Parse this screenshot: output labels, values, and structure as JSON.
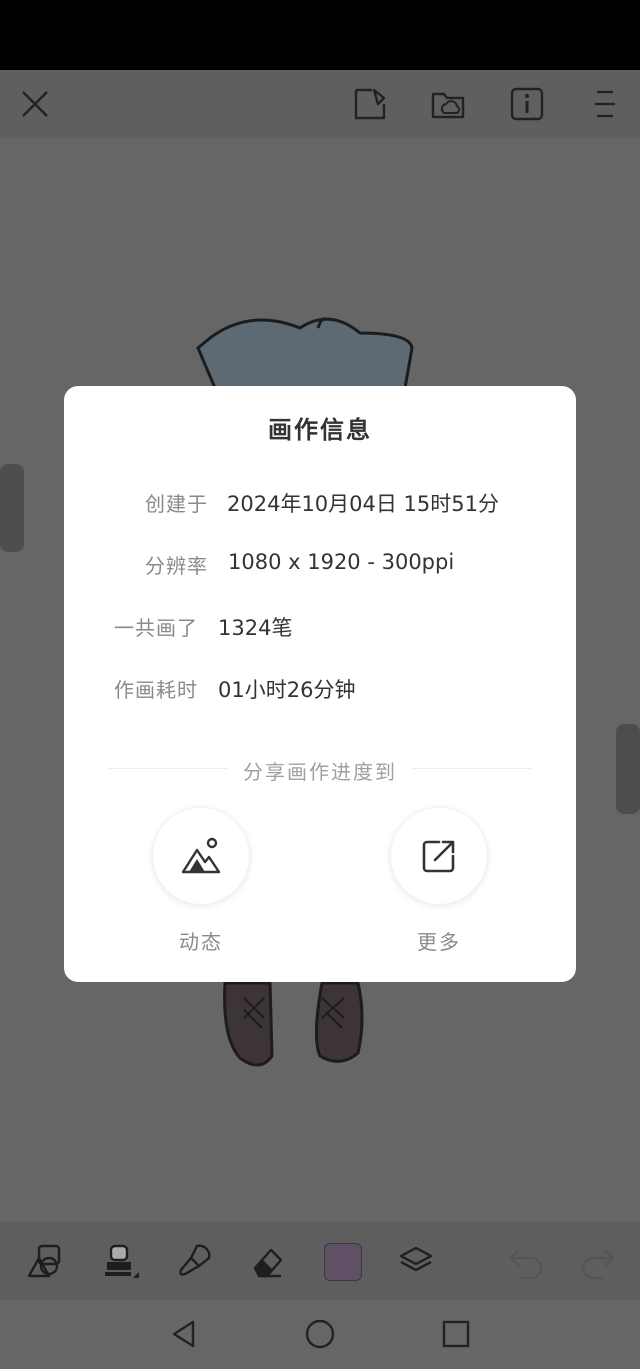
{
  "colors": {
    "accent_swatch": "#5f5066",
    "dialog_bg": "#ffffff",
    "dim_background": "#666666"
  },
  "top_bar": {
    "icons": [
      "close-icon",
      "export-image-icon",
      "cloud-folder-icon",
      "info-icon",
      "menu-icon"
    ]
  },
  "dialog": {
    "title": "画作信息",
    "rows": [
      {
        "label": "创建于",
        "value": "2024年10月04日 15时51分"
      },
      {
        "label": "分辨率",
        "value": "1080 x 1920 - 300ppi"
      },
      {
        "label": "一共画了",
        "value": "1324笔"
      },
      {
        "label": "作画耗时",
        "value": "01小时26分钟"
      }
    ],
    "share_title": "分享画作进度到",
    "share_options": [
      {
        "label": "动态",
        "icon": "mountain-image-icon"
      },
      {
        "label": "更多",
        "icon": "external-share-icon"
      }
    ]
  },
  "toolbar": {
    "tools": [
      "shape-icon",
      "brush-icon",
      "smudge-icon",
      "eraser-icon",
      "color-swatch",
      "layers-icon",
      "undo-icon",
      "redo-icon"
    ]
  },
  "nav": {
    "buttons": [
      "back-icon",
      "home-icon",
      "recents-icon"
    ]
  }
}
